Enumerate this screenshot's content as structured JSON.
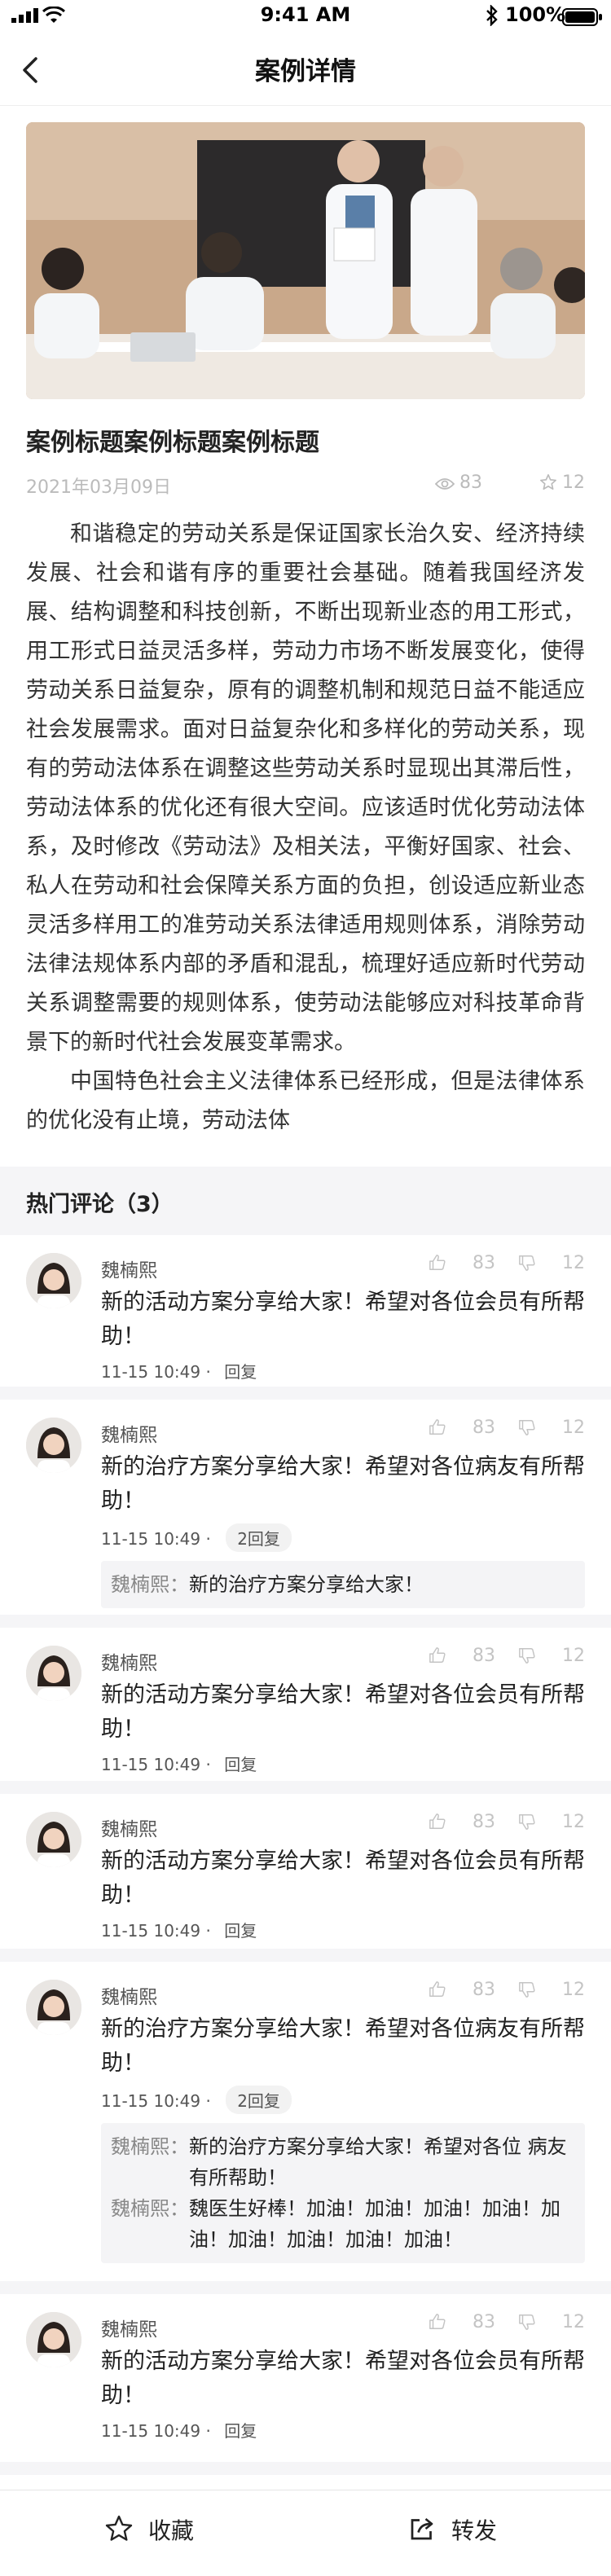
{
  "status_bar": {
    "time": "9:41 AM",
    "battery": "100%"
  },
  "nav": {
    "title": "案例详情",
    "back_icon": "chevron-left-icon"
  },
  "article": {
    "title": "案例标题案例标题案例标题",
    "date": "2021年03月09日",
    "views": "83",
    "likes": "12",
    "paragraphs": [
      "和谐稳定的劳动关系是保证国家长治久安、经济持续发展、社会和谐有序的重要社会基础。随着我国经济发展、结构调整和科技创新，不断出现新业态的用工形式，用工形式日益灵活多样，劳动力市场不断发展变化，使得劳动关系日益复杂，原有的调整机制和规范日益不能适应社会发展需求。面对日益复杂化和多样化的劳动关系，现有的劳动法体系在调整这些劳动关系时显现出其滞后性，劳动法体系的优化还有很大空间。应该适时优化劳动法体系，及时修改《劳动法》及相关法，平衡好国家、社会、私人在劳动和社会保障关系方面的负担，创设适应新业态灵活多样用工的准劳动关系法律适用规则体系，消除劳动法律法规体系内部的矛盾和混乱，梳理好适应新时代劳动关系调整需要的规则体系，使劳动法能够应对科技革命背景下的新时代社会发展变革需求。",
      "中国特色社会主义法律体系已经形成，但是法律体系的优化没有止境，劳动法体"
    ]
  },
  "comments_header": "热门评论（3）",
  "comments": [
    {
      "name": "魏楠熙",
      "likes": "83",
      "dislikes": "12",
      "text": "新的活动方案分享给大家！希望对各位会员有所帮助！",
      "date": "11-15",
      "time": "10:49",
      "reply_label": "回复",
      "replies": []
    },
    {
      "name": "魏楠熙",
      "likes": "83",
      "dislikes": "12",
      "text": "新的治疗方案分享给大家！希望对各位病友有所帮助！",
      "date": "11-15",
      "time": "10:49",
      "reply_label": "2回复",
      "replies": [
        {
          "name": "魏楠熙：",
          "text": "新的治疗方案分享给大家！"
        }
      ]
    },
    {
      "name": "魏楠熙",
      "likes": "83",
      "dislikes": "12",
      "text": "新的活动方案分享给大家！希望对各位会员有所帮助！",
      "date": "11-15",
      "time": "10:49",
      "reply_label": "回复",
      "replies": []
    },
    {
      "name": "魏楠熙",
      "likes": "83",
      "dislikes": "12",
      "text": "新的活动方案分享给大家！希望对各位会员有所帮助！",
      "date": "11-15",
      "time": "10:49",
      "reply_label": "回复",
      "replies": []
    },
    {
      "name": "魏楠熙",
      "likes": "83",
      "dislikes": "12",
      "text": "新的治疗方案分享给大家！希望对各位病友有所帮助！",
      "date": "11-15",
      "time": "10:49",
      "reply_label": "2回复",
      "replies": [
        {
          "name": "魏楠熙：",
          "text": "新的治疗方案分享给大家！希望对各位 病友有所帮助！"
        },
        {
          "name": "魏楠熙：",
          "text": "魏医生好棒！加油！加油！加油！加油！加油！加油！加油！加油！加油！"
        }
      ]
    },
    {
      "name": "魏楠熙",
      "likes": "83",
      "dislikes": "12",
      "text": "新的活动方案分享给大家！希望对各位会员有所帮助！",
      "date": "11-15",
      "time": "10:49",
      "reply_label": "回复",
      "replies": []
    }
  ],
  "bottom_bar": {
    "favorite_label": "收藏",
    "share_label": "转发",
    "favorite_icon": "star-outline-icon",
    "share_icon": "share-icon"
  },
  "colors": {
    "text_primary": "#222222",
    "text_muted": "#bbbbbb",
    "section_bg": "#f5f5f7",
    "reply_bg": "#f4f4f6"
  }
}
